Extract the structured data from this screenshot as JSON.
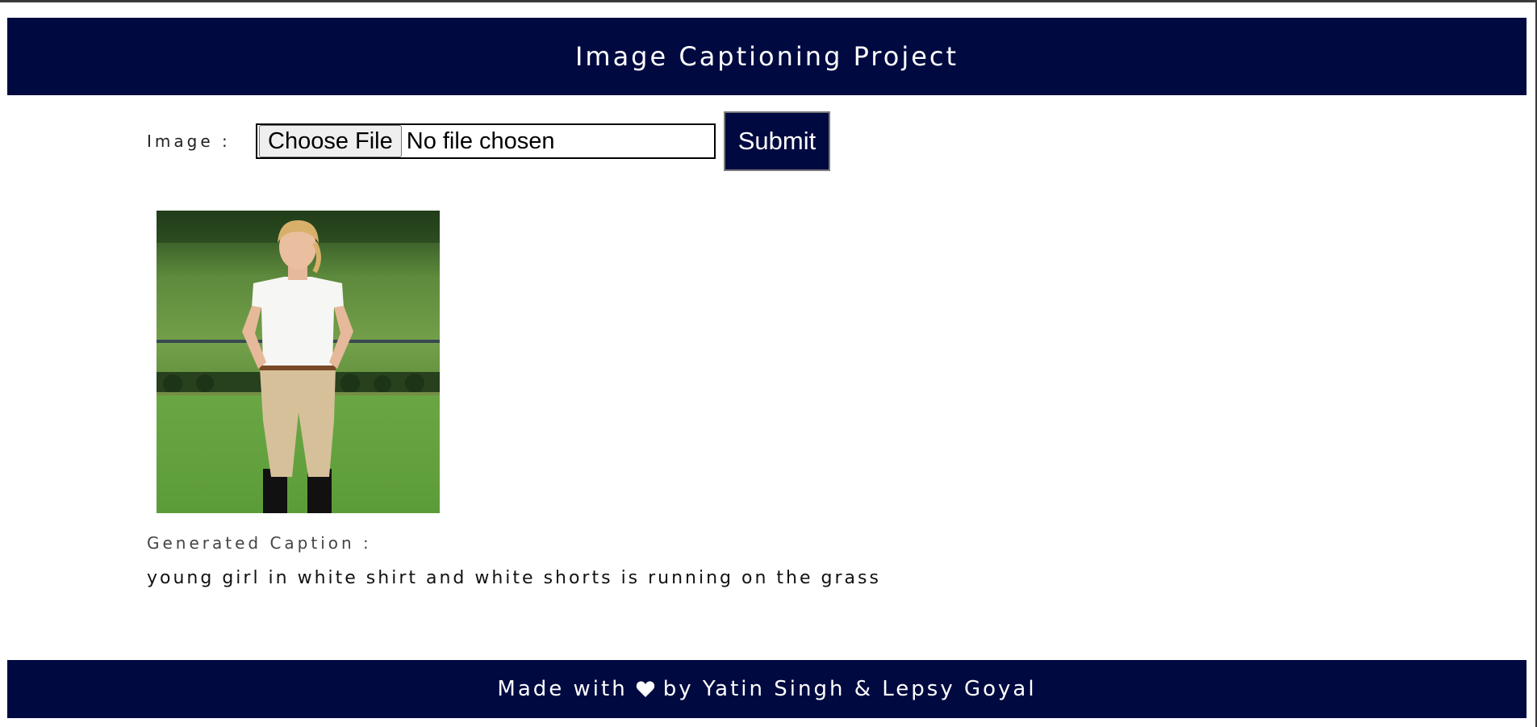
{
  "header": {
    "title": "Image Captioning Project"
  },
  "form": {
    "image_label": "Image :",
    "choose_file_label": "Choose File",
    "no_file_text": "No file chosen",
    "submit_label": "Submit"
  },
  "result": {
    "caption_label": "Generated Caption :",
    "caption_text": "young girl in white shirt and white shorts is running on the grass"
  },
  "footer": {
    "text_before": "Made with",
    "icon": "heart-icon",
    "text_after": "by Yatin Singh & Lepsy Goyal"
  },
  "colors": {
    "brand": "#000a40",
    "text_on_brand": "#ffffff"
  }
}
